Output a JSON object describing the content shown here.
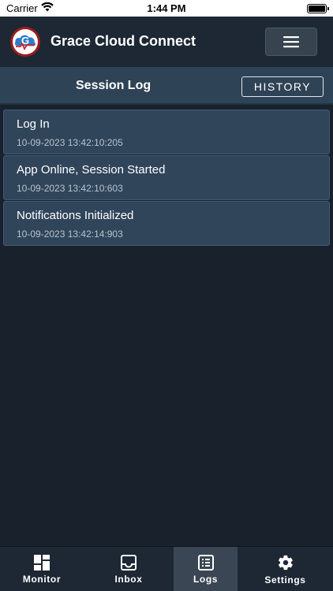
{
  "status_bar": {
    "carrier": "Carrier",
    "time": "1:44 PM"
  },
  "header": {
    "app_title": "Grace Cloud Connect",
    "logo_letter": "G",
    "menu_icon": "hamburger-menu-icon"
  },
  "subheader": {
    "title": "Session Log",
    "history_label": "HISTORY"
  },
  "logs": [
    {
      "title": "Log In",
      "timestamp": "10-09-2023 13:42:10:205"
    },
    {
      "title": "App Online, Session Started",
      "timestamp": "10-09-2023 13:42:10:603"
    },
    {
      "title": "Notifications Initialized",
      "timestamp": "10-09-2023 13:42:14:903"
    }
  ],
  "tabs": [
    {
      "label": "Monitor",
      "icon": "dashboard-icon",
      "active": false
    },
    {
      "label": "Inbox",
      "icon": "inbox-icon",
      "active": false
    },
    {
      "label": "Logs",
      "icon": "logs-icon",
      "active": true
    },
    {
      "label": "Settings",
      "icon": "gear-icon",
      "active": false
    }
  ],
  "colors": {
    "background": "#18212c",
    "header": "#1d2834",
    "subheader": "#2f4356",
    "log_item": "#30455a",
    "active_tab": "#3a4653"
  }
}
